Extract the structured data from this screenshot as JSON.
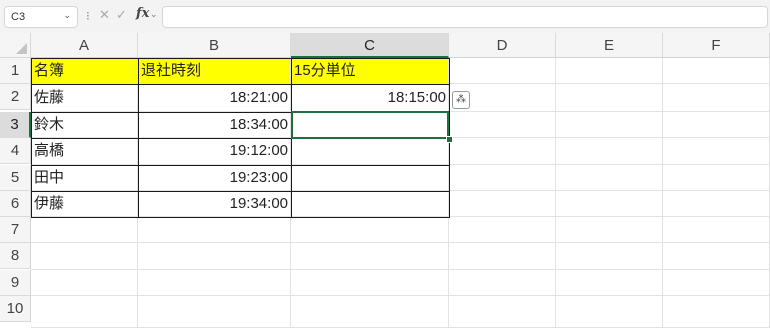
{
  "formula_bar": {
    "name_box": "C3",
    "name_box_arrow": "⌄",
    "separator": "⁝",
    "cancel_icon": "✕",
    "enter_icon": "✓",
    "fx_label": "fx",
    "fx_arrow": "⌄",
    "formula_value": ""
  },
  "columns": [
    "A",
    "B",
    "C",
    "D",
    "E",
    "F"
  ],
  "rows": [
    "1",
    "2",
    "3",
    "4",
    "5",
    "6",
    "7",
    "8",
    "9",
    "10"
  ],
  "selected_cell": "C3",
  "table": {
    "headers": {
      "a": "名簿",
      "b": "退社時刻",
      "c": "15分単位"
    },
    "rows": [
      {
        "a": "佐藤",
        "b": "18:21:00",
        "c": "18:15:00"
      },
      {
        "a": "鈴木",
        "b": "18:34:00",
        "c": ""
      },
      {
        "a": "高橋",
        "b": "19:12:00",
        "c": ""
      },
      {
        "a": "田中",
        "b": "19:23:00",
        "c": ""
      },
      {
        "a": "伊藤",
        "b": "19:34:00",
        "c": ""
      }
    ]
  },
  "flash_fill_icon": "⁂",
  "colors": {
    "header_fill": "#ffff00",
    "selection": "#1e6e3e"
  }
}
